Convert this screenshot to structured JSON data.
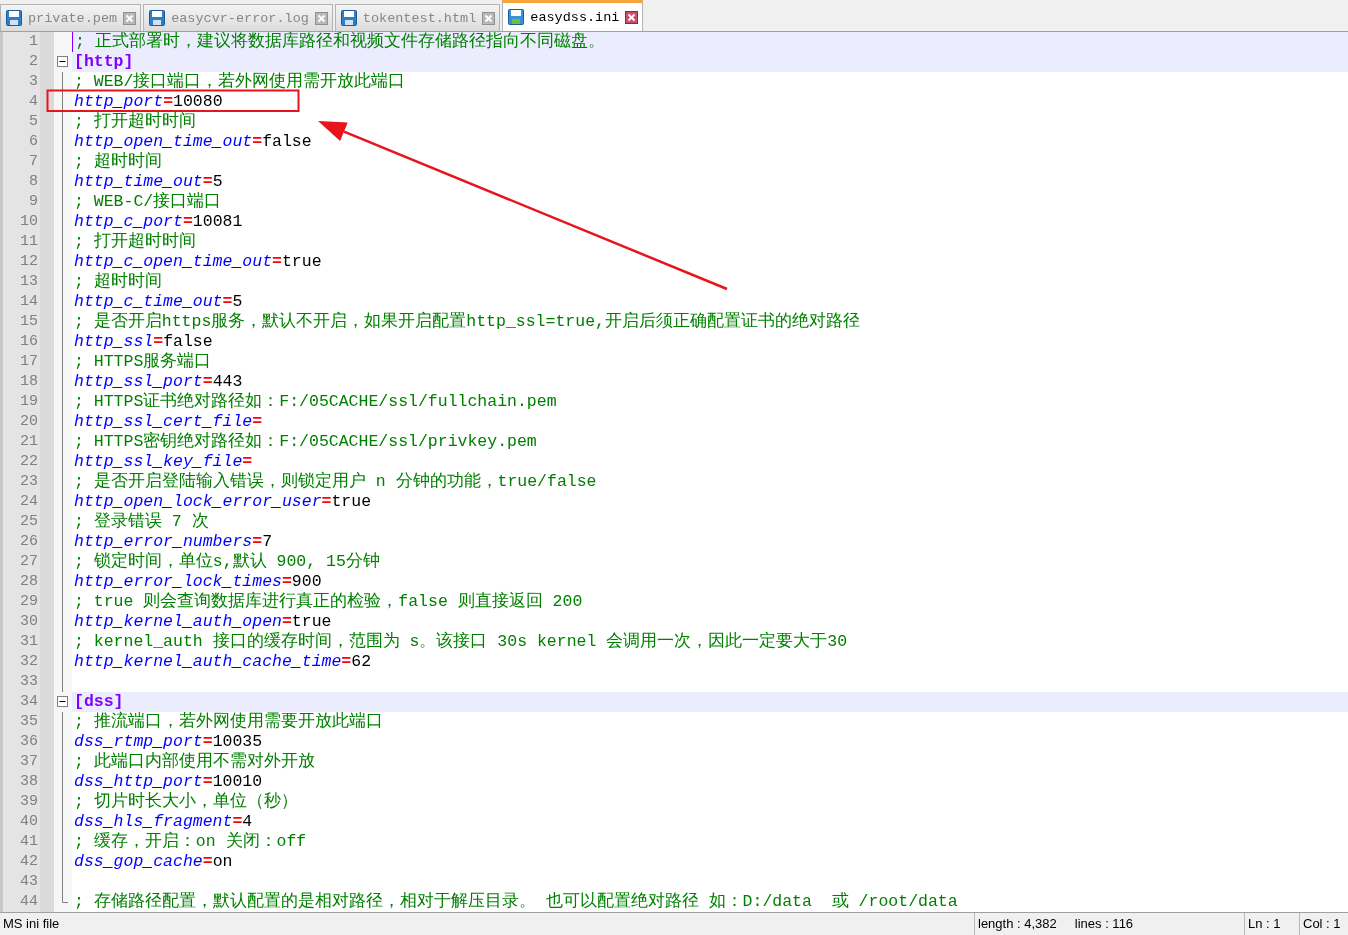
{
  "tabs": [
    {
      "label": "private.pem",
      "selected": false
    },
    {
      "label": "easycvr-error.log",
      "selected": false
    },
    {
      "label": "tokentest.html",
      "selected": false
    },
    {
      "label": "easydss.ini",
      "selected": true
    }
  ],
  "lines": [
    {
      "number": "1",
      "kind": "comment",
      "text": "; 正式部署时，建议将数据库路径和视频文件存储路径指向不同磁盘。",
      "current": true
    },
    {
      "number": "2",
      "kind": "section",
      "text": "[http]"
    },
    {
      "number": "3",
      "kind": "comment",
      "text": "; WEB/接口端口，若外网使用需开放此端口"
    },
    {
      "number": "4",
      "kind": "setting",
      "key": "http_port",
      "operator": "=",
      "value": "10080"
    },
    {
      "number": "5",
      "kind": "comment",
      "text": "; 打开超时时间"
    },
    {
      "number": "6",
      "kind": "setting",
      "key": "http_open_time_out",
      "operator": "=",
      "value": "false"
    },
    {
      "number": "7",
      "kind": "comment",
      "text": "; 超时时间"
    },
    {
      "number": "8",
      "kind": "setting",
      "key": "http_time_out",
      "operator": "=",
      "value": "5"
    },
    {
      "number": "9",
      "kind": "comment",
      "text": "; WEB-C/接口端口"
    },
    {
      "number": "10",
      "kind": "setting",
      "key": "http_c_port",
      "operator": "=",
      "value": "10081"
    },
    {
      "number": "11",
      "kind": "comment",
      "text": "; 打开超时时间"
    },
    {
      "number": "12",
      "kind": "setting",
      "key": "http_c_open_time_out",
      "operator": "=",
      "value": "true"
    },
    {
      "number": "13",
      "kind": "comment",
      "text": "; 超时时间"
    },
    {
      "number": "14",
      "kind": "setting",
      "key": "http_c_time_out",
      "operator": "=",
      "value": "5"
    },
    {
      "number": "15",
      "kind": "comment",
      "text": "; 是否开启https服务，默认不开启，如果开启配置http_ssl=true,开启后须正确配置证书的绝对路径"
    },
    {
      "number": "16",
      "kind": "setting",
      "key": "http_ssl",
      "operator": "=",
      "value": "false"
    },
    {
      "number": "17",
      "kind": "comment",
      "text": "; HTTPS服务端口"
    },
    {
      "number": "18",
      "kind": "setting",
      "key": "http_ssl_port",
      "operator": "=",
      "value": "443"
    },
    {
      "number": "19",
      "kind": "comment",
      "text": "; HTTPS证书绝对路径如：F:/05CACHE/ssl/fullchain.pem"
    },
    {
      "number": "20",
      "kind": "setting",
      "key": "http_ssl_cert_file",
      "operator": "="
    },
    {
      "number": "21",
      "kind": "comment",
      "text": "; HTTPS密钥绝对路径如：F:/05CACHE/ssl/privkey.pem"
    },
    {
      "number": "22",
      "kind": "setting",
      "key": "http_ssl_key_file",
      "operator": "="
    },
    {
      "number": "23",
      "kind": "comment",
      "text": "; 是否开启登陆输入错误，则锁定用户 n 分钟的功能，true/false"
    },
    {
      "number": "24",
      "kind": "setting",
      "key": "http_open_lock_error_user",
      "operator": "=",
      "value": "true"
    },
    {
      "number": "25",
      "kind": "comment",
      "text": "; 登录错误 7 次"
    },
    {
      "number": "26",
      "kind": "setting",
      "key": "http_error_numbers",
      "operator": "=",
      "value": "7"
    },
    {
      "number": "27",
      "kind": "comment",
      "text": "; 锁定时间，单位s,默认 900, 15分钟"
    },
    {
      "number": "28",
      "kind": "setting",
      "key": "http_error_lock_times",
      "operator": "=",
      "value": "900"
    },
    {
      "number": "29",
      "kind": "comment",
      "text": "; true 则会查询数据库进行真正的检验，false 则直接返回 200"
    },
    {
      "number": "30",
      "kind": "setting",
      "key": "http_kernel_auth_open",
      "operator": "=",
      "value": "true"
    },
    {
      "number": "31",
      "kind": "comment",
      "text": "; kernel_auth 接口的缓存时间，范围为 s。该接口 30s kernel 会调用一次，因此一定要大于30"
    },
    {
      "number": "32",
      "kind": "setting",
      "key": "http_kernel_auth_cache_time",
      "operator": "=",
      "value": "62"
    },
    {
      "number": "33",
      "kind": "blank"
    },
    {
      "number": "34",
      "kind": "section",
      "text": "[dss]"
    },
    {
      "number": "35",
      "kind": "comment",
      "text": "; 推流端口，若外网使用需要开放此端口"
    },
    {
      "number": "36",
      "kind": "setting",
      "key": "dss_rtmp_port",
      "operator": "=",
      "value": "10035"
    },
    {
      "number": "37",
      "kind": "comment",
      "text": "; 此端口内部使用不需对外开放"
    },
    {
      "number": "38",
      "kind": "setting",
      "key": "dss_http_port",
      "operator": "=",
      "value": "10010"
    },
    {
      "number": "39",
      "kind": "comment",
      "text": "; 切片时长大小，单位（秒）"
    },
    {
      "number": "40",
      "kind": "setting",
      "key": "dss_hls_fragment",
      "operator": "=",
      "value": "4"
    },
    {
      "number": "41",
      "kind": "comment",
      "text": "; 缓存，开启：on 关闭：off"
    },
    {
      "number": "42",
      "kind": "setting",
      "key": "dss_gop_cache",
      "operator": "=",
      "value": "on"
    },
    {
      "number": "43",
      "kind": "blank"
    },
    {
      "number": "44",
      "kind": "comment",
      "text": "; 存储路径配置，默认配置的是相对路径，相对于解压目录。 也可以配置绝对路径 如：D:/data  或 /root/data"
    }
  ],
  "status_bar": {
    "file_type": "MS ini file",
    "length": "length : 4,382",
    "lines": "lines : 116",
    "position": "Ln : 1",
    "column": "Col : 1"
  }
}
